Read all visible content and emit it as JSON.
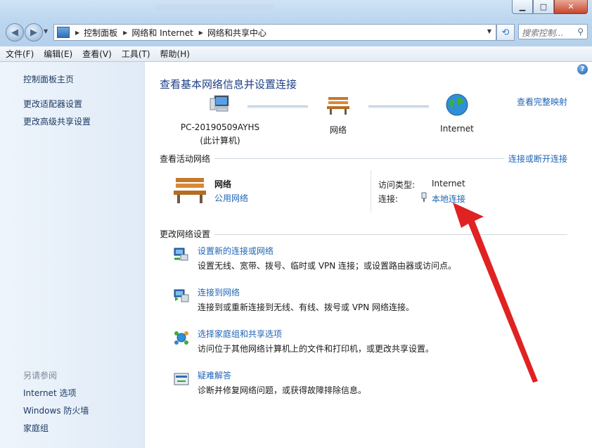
{
  "window": {
    "controls": {
      "minimize": "▁",
      "maximize": "□",
      "close": "✕"
    }
  },
  "address_bar": {
    "breadcrumbs": [
      "控制面板",
      "网络和 Internet",
      "网络和共享中心"
    ]
  },
  "search": {
    "placeholder": "搜索控制..."
  },
  "menu": [
    "文件(F)",
    "编辑(E)",
    "查看(V)",
    "工具(T)",
    "帮助(H)"
  ],
  "sidebar": {
    "items": [
      "控制面板主页",
      "更改适配器设置",
      "更改高级共享设置"
    ],
    "see_also_title": "另请参阅",
    "see_also": [
      "Internet 选项",
      "Windows 防火墙",
      "家庭组"
    ]
  },
  "main": {
    "title": "查看基本网络信息并设置连接",
    "full_map_link": "查看完整映射",
    "map": {
      "computer_name": "PC-20190509AYHS",
      "computer_sub": "(此计算机)",
      "network": "网络",
      "internet": "Internet"
    },
    "active_networks": {
      "label": "查看活动网络",
      "connect_link": "连接或断开连接",
      "network_name": "网络",
      "network_type": "公用网络",
      "access_type_label": "访问类型:",
      "access_type_value": "Internet",
      "connection_label": "连接:",
      "connection_value": "本地连接"
    },
    "change_settings": {
      "label": "更改网络设置",
      "tasks": [
        {
          "title": "设置新的连接或网络",
          "desc": "设置无线、宽带、拨号、临时或 VPN 连接；或设置路由器或访问点。"
        },
        {
          "title": "连接到网络",
          "desc": "连接到或重新连接到无线、有线、拨号或 VPN 网络连接。"
        },
        {
          "title": "选择家庭组和共享选项",
          "desc": "访问位于其他网络计算机上的文件和打印机，或更改共享设置。"
        },
        {
          "title": "疑难解答",
          "desc": "诊断并修复网络问题，或获得故障排除信息。"
        }
      ]
    }
  },
  "colors": {
    "link": "#1f64b5",
    "title": "#1e3f86",
    "annotation_arrow": "#e02222"
  }
}
